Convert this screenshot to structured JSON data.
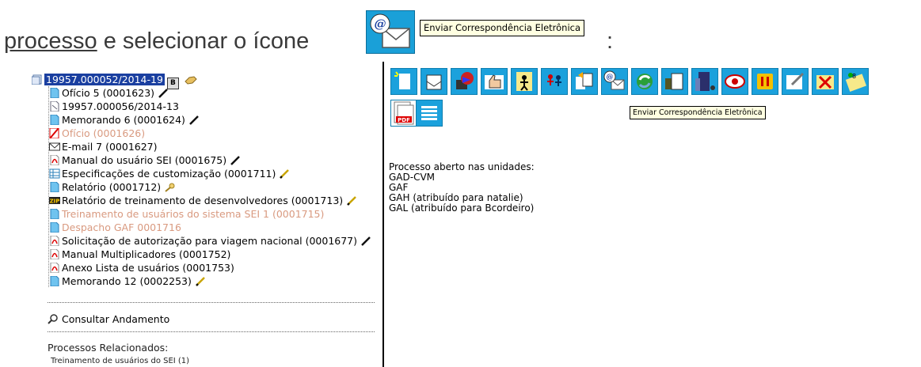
{
  "instruction": {
    "prefix_link": "processo",
    "rest": " e selecionar o ícone",
    "colon": ":",
    "tooltip": "Enviar Correspondência Eletrônica"
  },
  "tree": {
    "root": {
      "label": "19957.000052/2014-19",
      "badge": "B"
    },
    "items": [
      {
        "label": "Ofício 5 (0001623)",
        "icon": "document-icon",
        "muted": false,
        "pen": "black"
      },
      {
        "label": "19957.000056/2014-13",
        "icon": "process-icon",
        "muted": false,
        "pen": ""
      },
      {
        "label": "Memorando 6 (0001624)",
        "icon": "document-icon",
        "muted": false,
        "pen": "black"
      },
      {
        "label": "Ofício (0001626)",
        "icon": "canceled-document-icon",
        "muted": true,
        "pen": ""
      },
      {
        "label": "E-mail 7 (0001627)",
        "icon": "email-icon",
        "muted": false,
        "pen": ""
      },
      {
        "label": "Manual do usuário SEI (0001675)",
        "icon": "pdf-icon",
        "muted": false,
        "pen": "black"
      },
      {
        "label": "Especificações de customização (0001711)",
        "icon": "spreadsheet-icon",
        "muted": false,
        "pen": "yellow"
      },
      {
        "label": "Relatório (0001712)",
        "icon": "document-icon",
        "muted": false,
        "pen": "key"
      },
      {
        "label": "Relatório de treinamento de desenvolvedores (0001713)",
        "icon": "zip-icon",
        "muted": false,
        "pen": "yellow"
      },
      {
        "label": "Treinamento de usuários do sistema SEI 1 (0001715)",
        "icon": "document-icon",
        "muted": true,
        "pen": ""
      },
      {
        "label": "Despacho GAF 0001716",
        "icon": "document-icon",
        "muted": true,
        "pen": ""
      },
      {
        "label": "Solicitação de autorização para viagem nacional (0001677)",
        "icon": "pdf-icon",
        "muted": false,
        "pen": "black"
      },
      {
        "label": "Manual Multiplicadores (0001752)",
        "icon": "pdf-icon",
        "muted": false,
        "pen": ""
      },
      {
        "label": "Anexo Lista de usuários (0001753)",
        "icon": "pdf-icon",
        "muted": false,
        "pen": ""
      },
      {
        "label": "Memorando 12 (0002253)",
        "icon": "document-icon",
        "muted": false,
        "pen": "yellow"
      }
    ]
  },
  "consult_label": "Consultar Andamento",
  "related": {
    "heading": "Processos Relacionados:",
    "items": [
      "Treinamento de usuários do SEI (1)"
    ]
  },
  "toolbar": {
    "tooltip": "Enviar Correspondência Eletrônica",
    "buttons": [
      "new-document-icon",
      "receive-mail-icon",
      "send-process-icon",
      "thumbs-up-icon",
      "assign-user-icon",
      "assign-group-icon",
      "relate-process-icon",
      "send-email-icon",
      "refresh-icon",
      "documents-icon",
      "building-icon",
      "eye-icon",
      "pause-icon",
      "edit-icon",
      "no-access-icon",
      "credentials-icon",
      "pdf-export-icon",
      "list-icon"
    ]
  },
  "info": {
    "heading": "Processo aberto nas unidades:",
    "units": [
      "GAD-CVM",
      "GAF",
      "GAH (atribuído para natalie)",
      "GAL (atribuído para Bcordeiro)"
    ]
  }
}
